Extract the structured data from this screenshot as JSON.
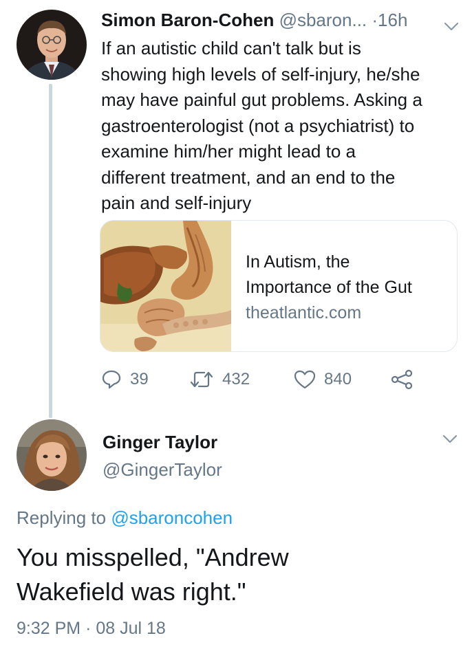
{
  "tweet": {
    "author_name": "Simon Baron-Cohen",
    "author_handle": "@sbaron...",
    "separator": "·",
    "time_ago": "16h",
    "text_lines": [
      "If an autistic child can't talk but is",
      "showing high levels of self-injury, he/she",
      "may have painful gut problems. Asking a",
      "gastroenterologist (not a psychiatrist) to",
      "examine him/her might lead to a",
      "different treatment, and an end to the",
      "pain and self-injury"
    ],
    "card": {
      "title_line1": "In Autism, the",
      "title_line2": "Importance of the Gut",
      "domain": "theatlantic.com"
    },
    "actions": {
      "replies": "39",
      "retweets": "432",
      "likes": "840"
    }
  },
  "reply": {
    "author_name": "Ginger Taylor",
    "author_handle": "@GingerTaylor",
    "replying_prefix": "Replying to",
    "replying_to": "@sbaroncohen",
    "text_line1": "You misspelled, \"Andrew",
    "text_line2": "Wakefield was right.\"",
    "time": "9:32 PM",
    "meta_separator": "·",
    "date": "08 Jul 18"
  },
  "colors": {
    "text": "#14171a",
    "secondary": "#657786",
    "link": "#1da1f2",
    "border": "#e1e8ed",
    "thread_line": "#ccd6dd"
  },
  "icons": [
    "chevron-down-icon",
    "reply-icon",
    "retweet-icon",
    "heart-icon",
    "share-icon"
  ]
}
